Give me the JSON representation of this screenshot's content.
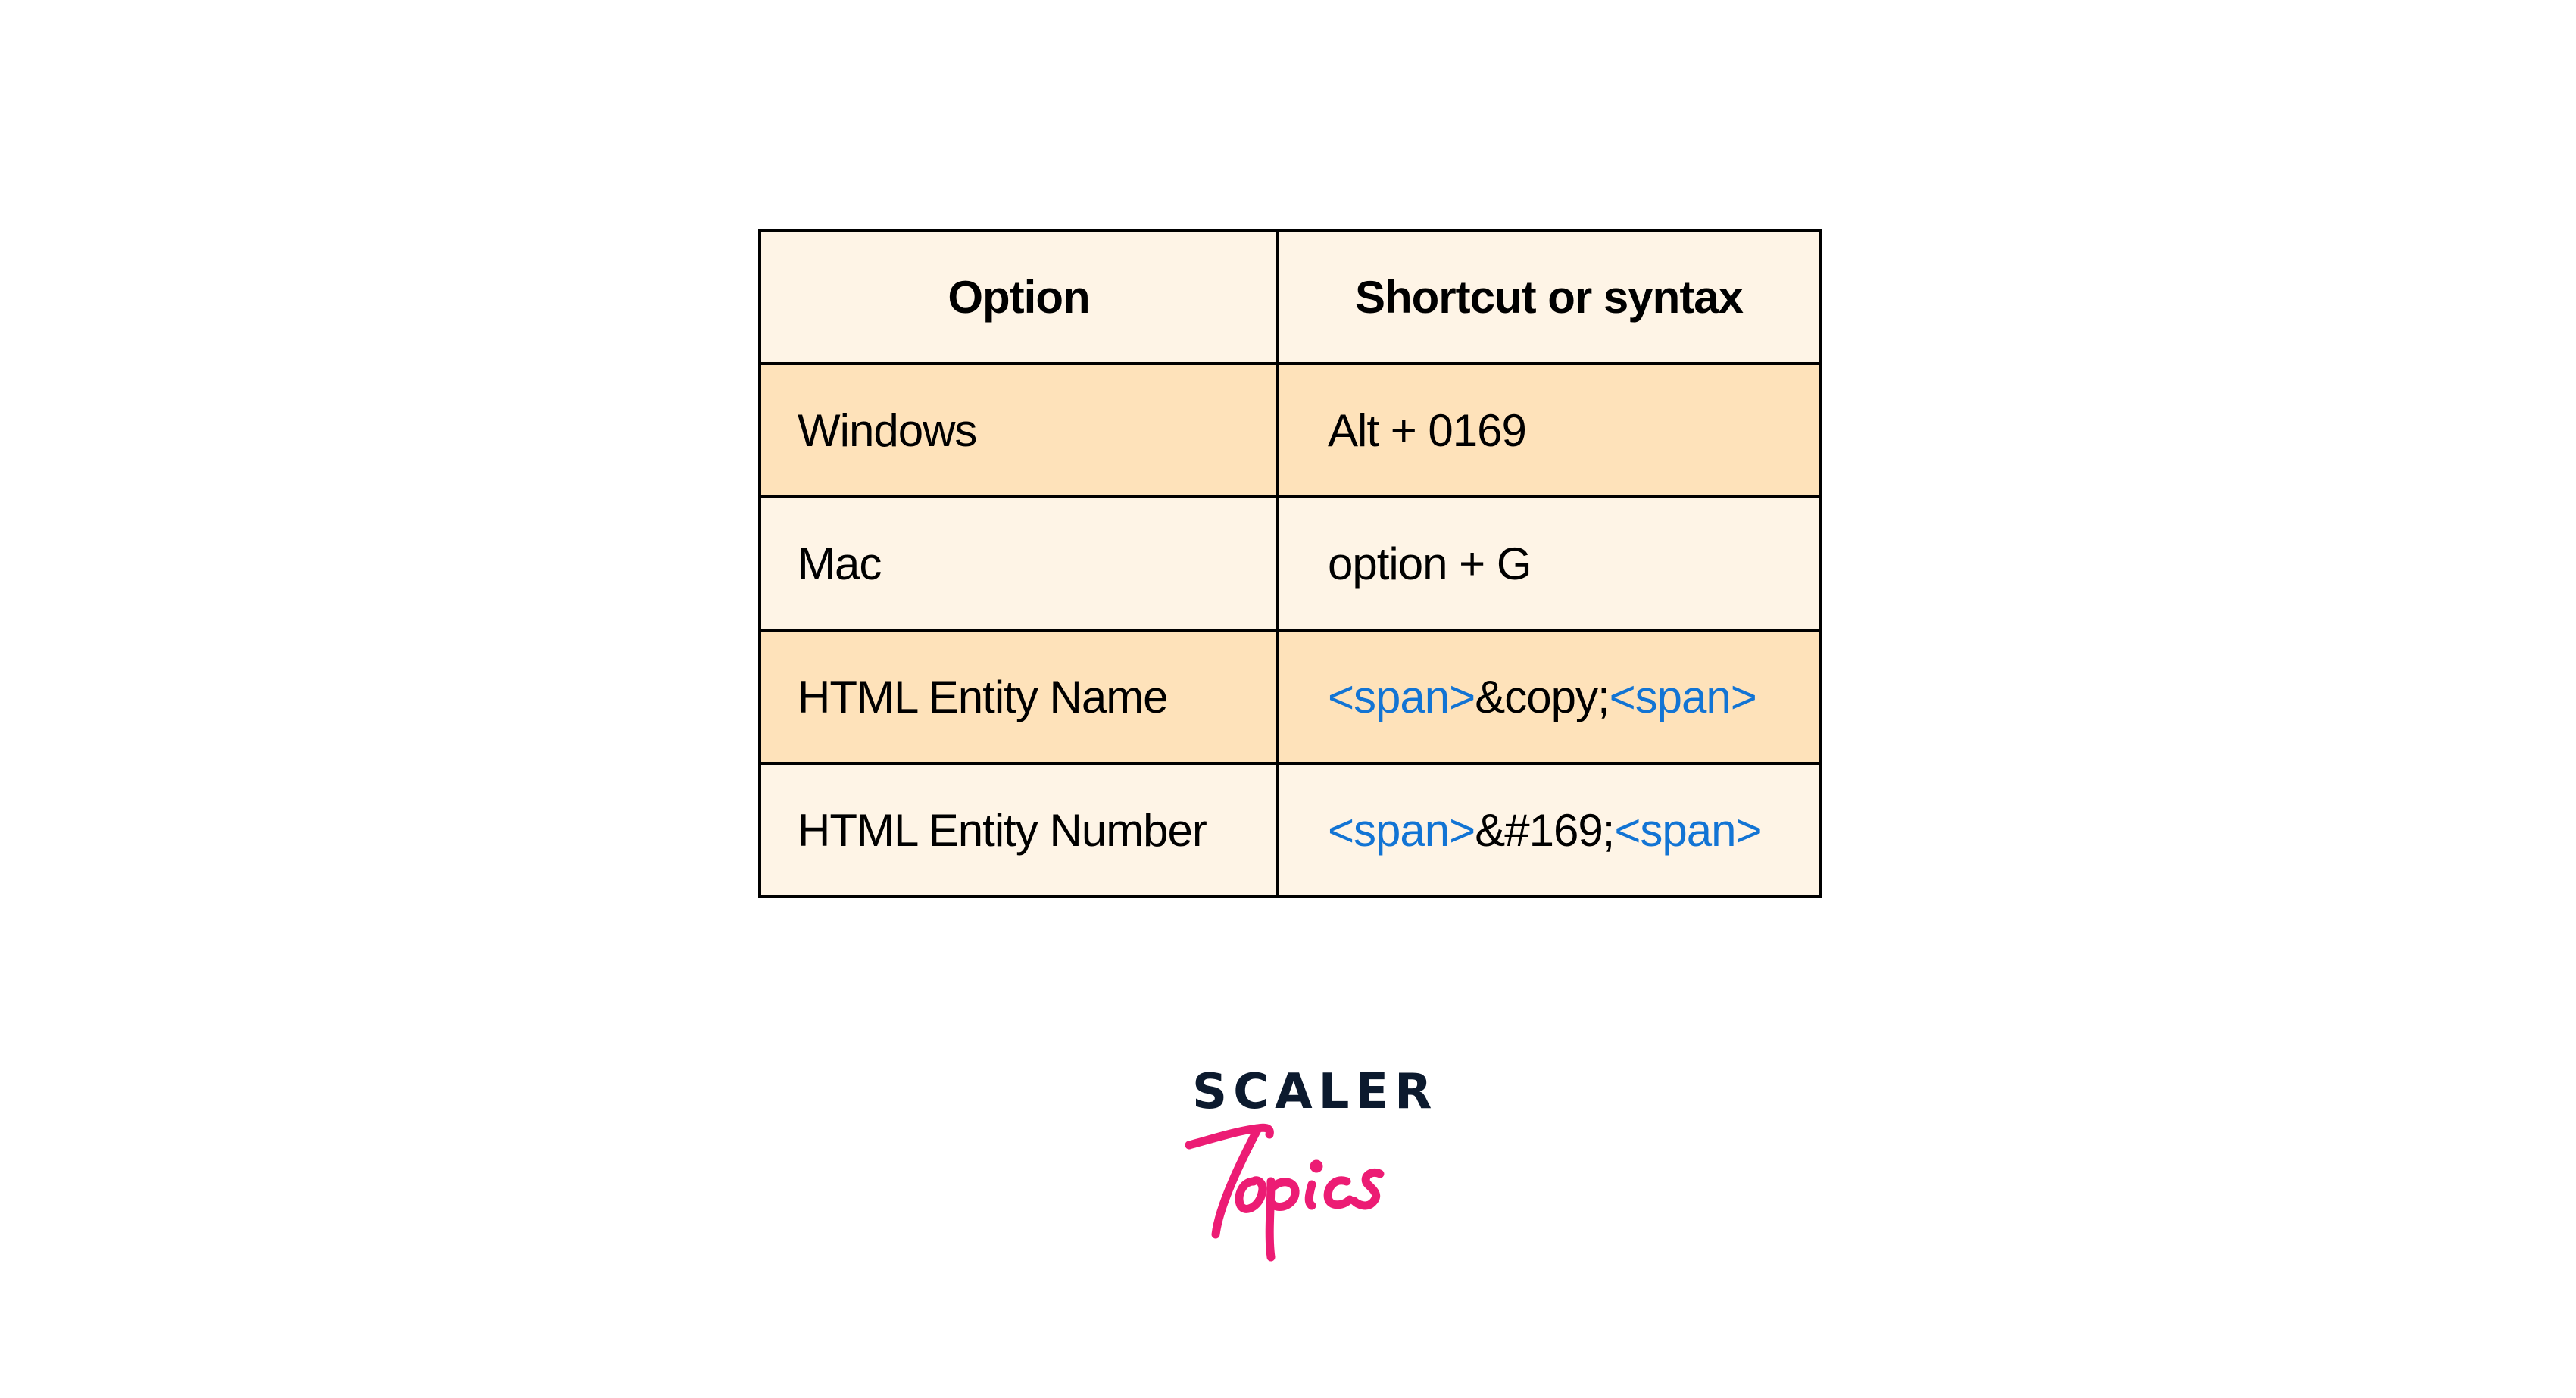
{
  "table": {
    "headers": [
      "Option",
      "Shortcut or syntax"
    ],
    "rows": [
      {
        "option": "Windows",
        "value_parts": [
          {
            "text": "Alt + 0169",
            "kind": "plain"
          }
        ]
      },
      {
        "option": "Mac",
        "value_parts": [
          {
            "text": "option + G",
            "kind": "plain"
          }
        ]
      },
      {
        "option": "HTML Entity Name",
        "value_parts": [
          {
            "text": "<span>",
            "kind": "tag"
          },
          {
            "text": "&copy;",
            "kind": "plain"
          },
          {
            "text": "<span>",
            "kind": "tag"
          }
        ]
      },
      {
        "option": "HTML Entity Number",
        "value_parts": [
          {
            "text": "<span>",
            "kind": "tag"
          },
          {
            "text": "&#169;",
            "kind": "plain"
          },
          {
            "text": "<span>",
            "kind": "tag"
          }
        ]
      }
    ]
  },
  "colors": {
    "header_bg": "#FEF4E6",
    "row_light_bg": "#FEF4E6",
    "row_dark_bg": "#FEE2BA",
    "tag_text": "#1274D4",
    "border": "#000000",
    "logo_dark": "#0C1A2E",
    "logo_pink": "#EC1C74"
  },
  "logo": {
    "top_text": "SCALER",
    "script_text": "Topics"
  }
}
